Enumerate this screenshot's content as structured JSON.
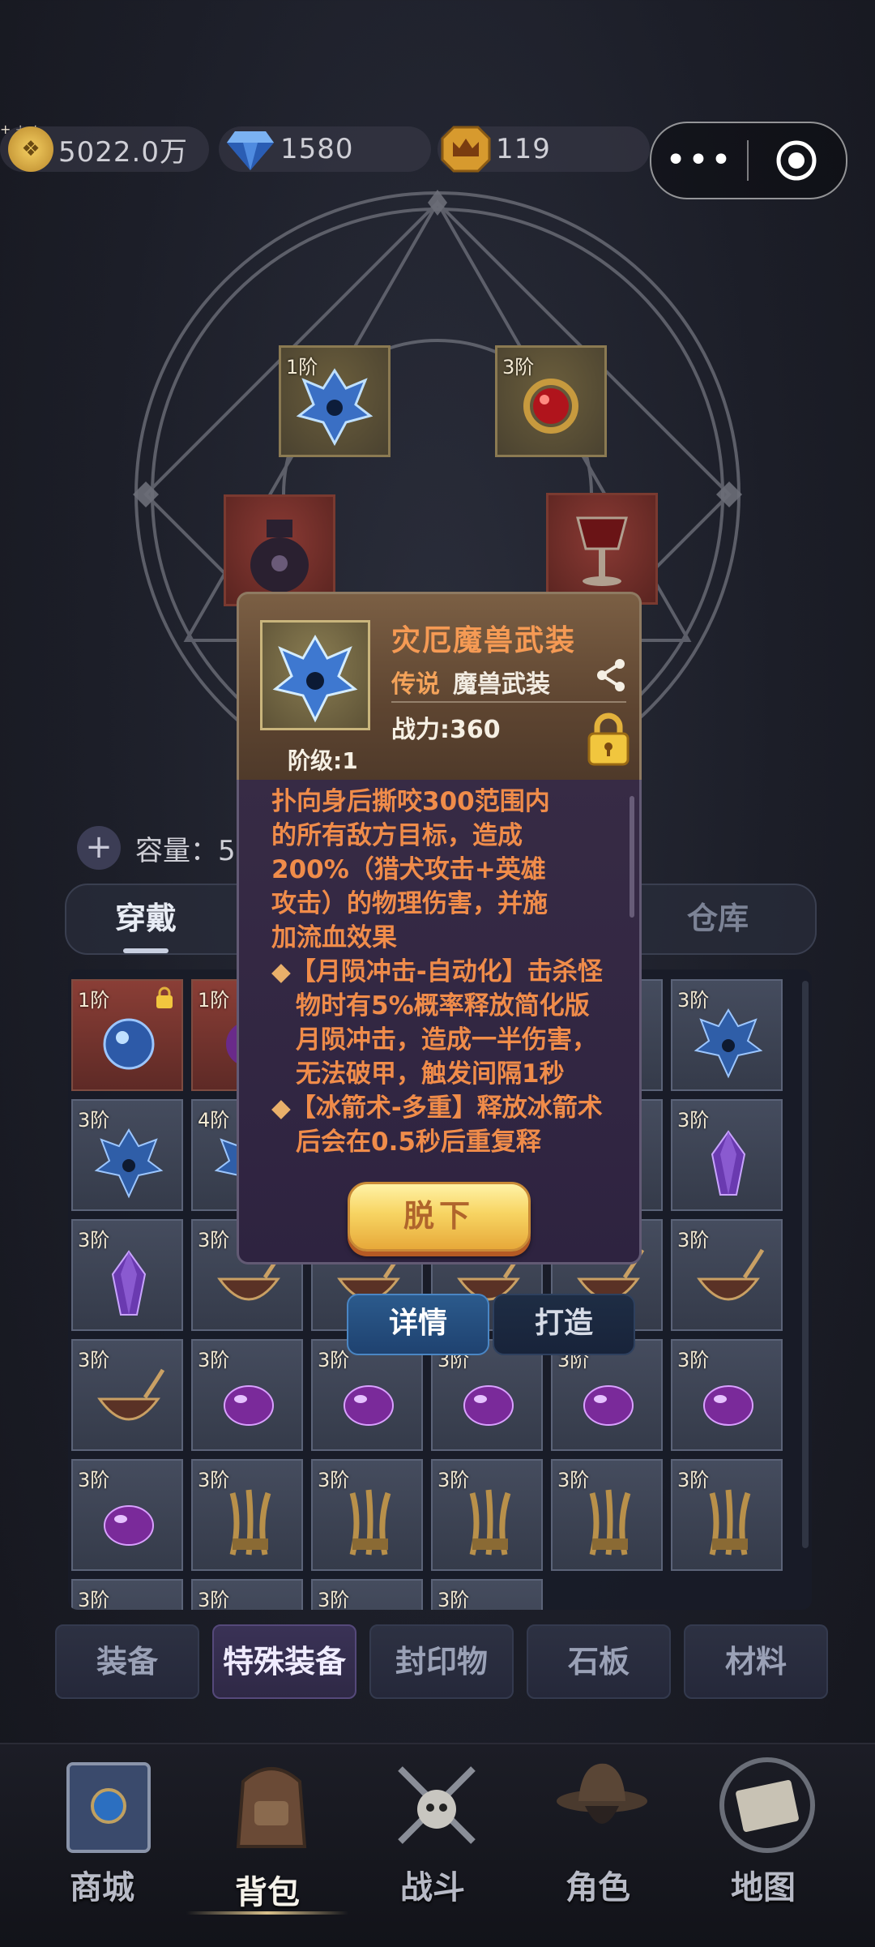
{
  "currencies": [
    {
      "name": "gold-coin",
      "value": "5022.0万"
    },
    {
      "name": "diamond",
      "value": "1580"
    },
    {
      "name": "crown",
      "value": "119"
    }
  ],
  "capsule": {
    "menu_icon": "more-dots-icon",
    "close_icon": "target-icon"
  },
  "equipped_slots": [
    {
      "tier": "1阶",
      "icon": "blue-dragon-helm-icon"
    },
    {
      "tier": "3阶",
      "icon": "red-orb-amulet-icon"
    },
    {
      "tier": "",
      "icon": "dark-urn-icon"
    },
    {
      "tier": "",
      "icon": "blood-chalice-icon"
    }
  ],
  "capacity": {
    "label": "容量：5"
  },
  "subtabs": {
    "equipped": "穿戴",
    "warehouse": "仓库"
  },
  "grid": [
    [
      {
        "tier": "1阶",
        "icon": "blue-orb-icon",
        "locked": true
      },
      {
        "tier": "1阶",
        "icon": "purple-orb-icon"
      },
      {
        "tier": "",
        "icon": ""
      },
      {
        "tier": "",
        "icon": ""
      },
      {
        "tier": "",
        "icon": ""
      },
      {
        "tier": "3阶",
        "icon": "blue-helm-icon"
      }
    ],
    [
      {
        "tier": "3阶",
        "icon": "blue-helm-icon"
      },
      {
        "tier": "4阶",
        "icon": "blue-helm-icon"
      },
      {
        "tier": "",
        "icon": ""
      },
      {
        "tier": "",
        "icon": ""
      },
      {
        "tier": "",
        "icon": ""
      },
      {
        "tier": "3阶",
        "icon": "purple-crystal-icon"
      }
    ],
    [
      {
        "tier": "3阶",
        "icon": "purple-crystal-icon"
      },
      {
        "tier": "3阶",
        "icon": "horn-bowl-icon"
      },
      {
        "tier": "",
        "icon": "horn-bowl-icon"
      },
      {
        "tier": "",
        "icon": "horn-bowl-icon"
      },
      {
        "tier": "",
        "icon": "horn-bowl-icon"
      },
      {
        "tier": "3阶",
        "icon": "horn-bowl-icon"
      }
    ],
    [
      {
        "tier": "3阶",
        "icon": "horn-bowl-icon"
      },
      {
        "tier": "3阶",
        "icon": "purple-gem-icon"
      },
      {
        "tier": "3阶",
        "icon": "purple-gem-icon"
      },
      {
        "tier": "3阶",
        "icon": "purple-gem-icon"
      },
      {
        "tier": "3阶",
        "icon": "purple-gem-icon"
      },
      {
        "tier": "3阶",
        "icon": "purple-gem-icon"
      }
    ],
    [
      {
        "tier": "3阶",
        "icon": "purple-gem-icon"
      },
      {
        "tier": "3阶",
        "icon": "gold-claw-icon"
      },
      {
        "tier": "3阶",
        "icon": "gold-claw-icon"
      },
      {
        "tier": "3阶",
        "icon": "gold-claw-icon"
      },
      {
        "tier": "3阶",
        "icon": "gold-claw-icon"
      },
      {
        "tier": "3阶",
        "icon": "gold-claw-icon"
      }
    ],
    [
      {
        "tier": "3阶",
        "icon": ""
      },
      {
        "tier": "3阶",
        "icon": ""
      },
      {
        "tier": "3阶",
        "icon": ""
      },
      {
        "tier": "3阶",
        "icon": ""
      }
    ]
  ],
  "categories": [
    "装备",
    "特殊装备",
    "封印物",
    "石板",
    "材料"
  ],
  "active_category": 1,
  "nav": [
    {
      "label": "商城",
      "icon": "shop-book-icon"
    },
    {
      "label": "背包",
      "icon": "backpack-icon"
    },
    {
      "label": "战斗",
      "icon": "battle-skull-icon"
    },
    {
      "label": "角色",
      "icon": "character-hat-icon"
    },
    {
      "label": "地图",
      "icon": "map-scroll-icon"
    }
  ],
  "active_nav": 1,
  "popup": {
    "name": "灾厄魔兽武装",
    "rarity": "传说",
    "type": "魔兽武装",
    "power": "战力:360",
    "tier": "阶级:1",
    "description": {
      "line1": "扑向身后撕咬300范围内",
      "line2": "的所有敌方目标，造成",
      "line3": "200%（猎犬攻击+英雄",
      "line4": "攻击）的物理伤害，并施",
      "line5": "加流血效果",
      "bullet1": "【月陨冲击-自动化】击杀怪物时有5%概率释放简化版月陨冲击，造成一半伤害，无法破甲，触发间隔1秒",
      "bullet2": "【冰箭术-多重】释放冰箭术后会在0.5秒后重复释"
    },
    "unequip": "脱下",
    "detail_tab": "详情",
    "forge_tab": "打造"
  },
  "colors": {
    "accent_orange": "#f59a54",
    "legend_gold": "#f7d462",
    "detail_blue": "#2b5a8c"
  }
}
